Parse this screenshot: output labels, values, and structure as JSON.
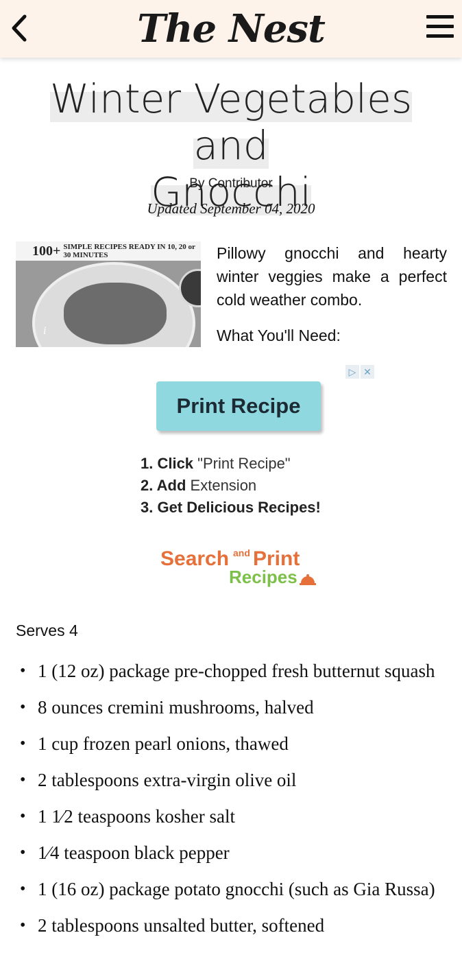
{
  "header": {
    "brand": "The Nest",
    "back_icon": "chevron-left-icon",
    "menu_icon": "hamburger-menu-icon"
  },
  "article": {
    "title_line1": "Winter Vegetables and",
    "title_line2": "Gnocchi",
    "byline": "By Contributor",
    "updated": "Updated September 04, 2020",
    "image_banner_big": "100+",
    "image_banner_small": "SIMPLE RECIPES READY IN 10, 20 or 30 MINUTES",
    "image_info_icon": "i",
    "intro": "Pillowy gnocchi and hearty winter veggies make a perfect cold weather combo.",
    "need": "What You'll Need:"
  },
  "ad": {
    "adchoices_icon": "▷",
    "close_icon": "✕",
    "print_button": "Print Recipe",
    "step1_bold": "1. Click",
    "step1_rest": "\"Print Recipe\"",
    "step2_bold": "2. Add",
    "step2_rest": "Extension",
    "step3_bold": "3. Get Delicious Recipes!",
    "logo_search": "Search",
    "logo_and": "and",
    "logo_print": "Print",
    "logo_recipes": "Recipes"
  },
  "recipe": {
    "serves": "Serves 4",
    "ingredients": [
      "1 (12 oz) package pre-chopped fresh butternut squash",
      "8 ounces cremini mushrooms, halved",
      "1 cup frozen pearl onions, thawed",
      "2 tablespoons extra-virgin olive oil",
      "1 1⁄2 teaspoons kosher salt",
      "1⁄4 teaspoon black pepper",
      "1 (16 oz) package potato gnocchi (such as Gia Russa)",
      "2 tablespoons unsalted butter, softened"
    ]
  },
  "colors": {
    "header_bg": "#fdf3ea",
    "print_button_bg": "#8fd8e0",
    "logo_orange": "#e5703a",
    "logo_green": "#7cc04a"
  }
}
